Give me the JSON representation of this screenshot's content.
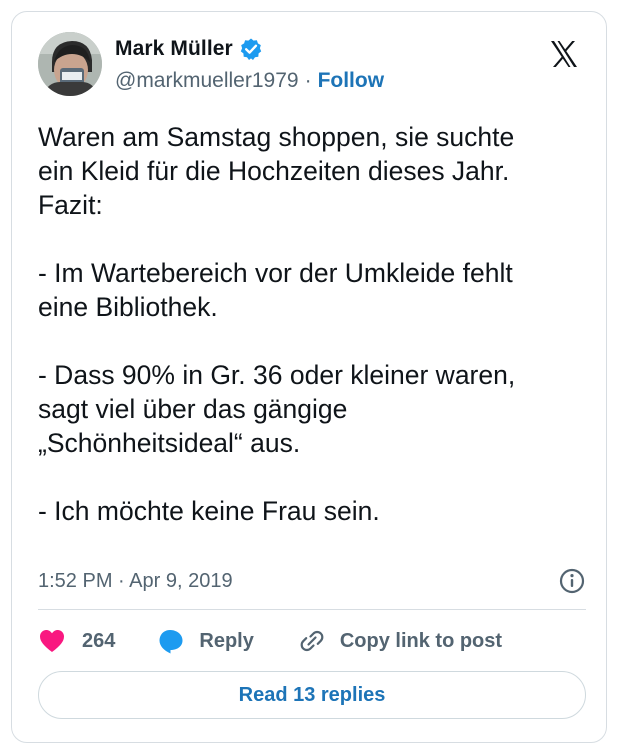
{
  "author": {
    "display_name": "Mark Müller",
    "handle": "@markmueller1979",
    "separator": "·",
    "follow_label": "Follow",
    "verified": true,
    "avatar_icon": "avatar-photo"
  },
  "tweet": {
    "paragraphs": [
      "Waren am Samstag shoppen, sie suchte\nein Kleid für die Hochzeiten dieses Jahr.\nFazit:",
      "- Im Wartebereich vor der Umkleide fehlt\neine Bibliothek.",
      "- Dass 90% in Gr. 36 oder kleiner waren,\nsagt viel über das gängige\n„Schönheitsideal“ aus.",
      "- Ich möchte keine Frau sein."
    ],
    "timestamp": "1:52 PM · Apr 9, 2019"
  },
  "actions": {
    "like_count": "264",
    "reply_label": "Reply",
    "copy_link_label": "Copy link to post"
  },
  "read_replies_label": "Read 13 replies",
  "colors": {
    "link": "#1d74b7",
    "verified": "#1d9bf0",
    "heart": "#f91880",
    "reply": "#1d9bf0",
    "muted": "#536471",
    "text": "#0f1419",
    "border": "#d7dde2"
  },
  "icons": [
    "verified-badge-icon",
    "x-logo-icon",
    "info-icon",
    "heart-icon",
    "reply-bubble-icon",
    "link-icon"
  ]
}
